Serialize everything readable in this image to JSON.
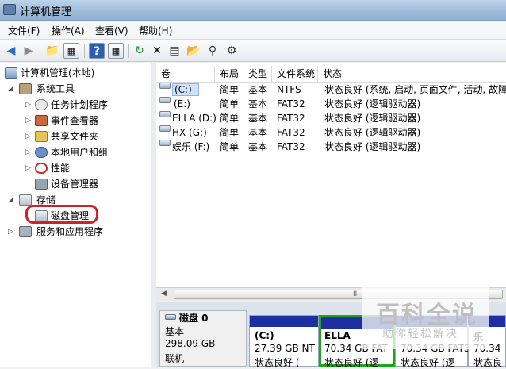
{
  "window": {
    "title": "计算机管理"
  },
  "menu": [
    "文件(F)",
    "操作(A)",
    "查看(V)",
    "帮助(H)"
  ],
  "toolbar": {
    "icons": [
      "back-arrow-icon",
      "forward-arrow-icon",
      "up-folder-icon",
      "show-hide-tree-icon",
      "help-icon",
      "panel-icon",
      "refresh-icon",
      "delete-icon",
      "properties-icon",
      "open-icon",
      "search-icon",
      "settings-icon"
    ]
  },
  "tree": {
    "root": "计算机管理(本地)",
    "system_tools": "系统工具",
    "task_scheduler": "任务计划程序",
    "event_viewer": "事件查看器",
    "shared_folders": "共享文件夹",
    "local_users": "本地用户和组",
    "performance": "性能",
    "device_manager": "设备管理器",
    "storage": "存储",
    "disk_management": "磁盘管理",
    "services_apps": "服务和应用程序"
  },
  "grid": {
    "headers": [
      "卷",
      "布局",
      "类型",
      "文件系统",
      "状态"
    ],
    "rows": [
      [
        "(C:)",
        "简单",
        "基本",
        "NTFS",
        "状态良好 (系统, 启动, 页面文件, 活动, 故障"
      ],
      [
        "(E:)",
        "简单",
        "基本",
        "FAT32",
        "状态良好 (逻辑驱动器)"
      ],
      [
        "ELLA (D:)",
        "简单",
        "基本",
        "FAT32",
        "状态良好 (逻辑驱动器)"
      ],
      [
        "HX (G:)",
        "简单",
        "基本",
        "FAT32",
        "状态良好 (逻辑驱动器)"
      ],
      [
        "娱乐 (F:)",
        "简单",
        "基本",
        "FAT32",
        "状态良好 (逻辑驱动器)"
      ]
    ]
  },
  "scroll": {
    "grip": "III"
  },
  "disk": {
    "name": "磁盘 0",
    "type": "基本",
    "size": "298.09 GB",
    "status": "联机"
  },
  "partitions": [
    {
      "name": "(C:)",
      "size": "27.39 GB NT",
      "status": "状态良好 ("
    },
    {
      "name": "ELLA",
      "size": "70.34 GB FAT",
      "status": "状态良好 (逻"
    },
    {
      "name": "",
      "size": "70.34 GB FAT3",
      "status": "状态良好 (逻"
    },
    {
      "name": "乐",
      "size": "70.34",
      "status": "状态良"
    }
  ],
  "watermark": {
    "main": "百科全说",
    "sub": "助你轻松解决"
  },
  "colors": {
    "partition_bar": "#1b2fa0",
    "selected_border": "#1ea51e",
    "highlight_circle": "#d41e2a"
  }
}
